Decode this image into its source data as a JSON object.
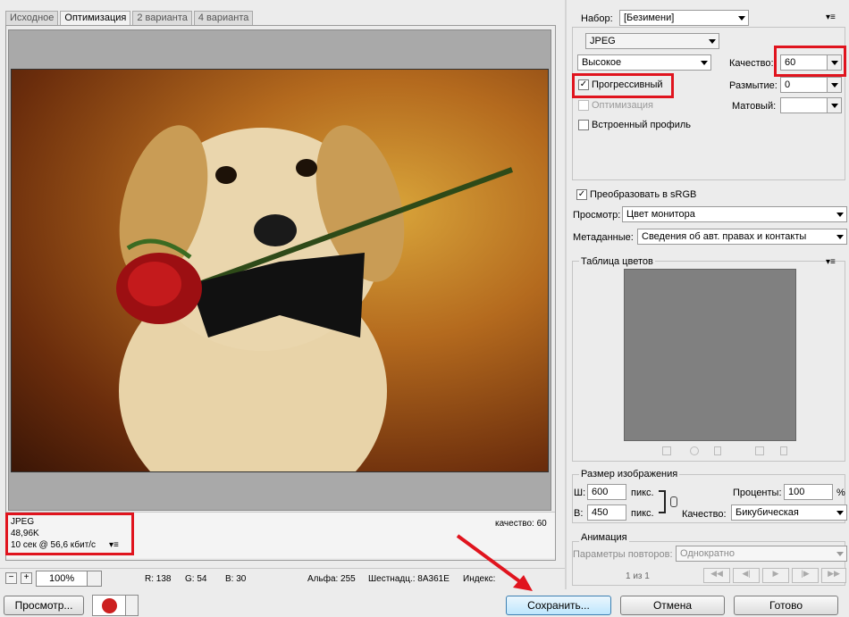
{
  "tabs": [
    "Исходное",
    "Оптимизация",
    "2 варианта",
    "4 варианта"
  ],
  "info": {
    "format": "JPEG",
    "size": "48,96K",
    "speed": "10 сек @ 56,6 кбит/с",
    "quality": "качество: 60"
  },
  "status": {
    "zoom": "100%",
    "r": "R: 138",
    "g": "G: 54",
    "b": "B: 30",
    "alpha": "Альфа: 255",
    "hex": "Шестнадц.: 8A361E",
    "index": "Индекс:"
  },
  "buttons": {
    "preview": "Просмотр...",
    "save": "Сохранить...",
    "cancel": "Отмена",
    "done": "Готово"
  },
  "settings": {
    "preset_label": "Набор:",
    "preset_value": "[Безимени]",
    "format_value": "JPEG",
    "quality_level": "Высокое",
    "quality_label": "Качество:",
    "quality_value": "60",
    "progressive": "Прогрессивный",
    "blur_label": "Размытие:",
    "blur_value": "0",
    "optimized": "Оптимизация",
    "matte_label": "Матовый:",
    "matte_value": "",
    "icc_profile": "Встроенный профиль",
    "srgb": "Преобразовать в sRGB",
    "preview_label": "Просмотр:",
    "preview_value": "Цвет монитора",
    "metadata_label": "Метаданные:",
    "metadata_value": "Сведения об авт. правах и контакты"
  },
  "color_table": {
    "title": "Таблица цветов"
  },
  "image_size": {
    "title": "Размер изображения",
    "w_label": "Ш:",
    "w_value": "600",
    "w_unit": "пикс.",
    "h_label": "В:",
    "h_value": "450",
    "h_unit": "пикс.",
    "percent_label": "Проценты:",
    "percent_value": "100",
    "percent_sign": "%",
    "quality_label": "Качество:",
    "quality_value": "Бикубическая"
  },
  "animation": {
    "title": "Анимация",
    "loop_label": "Параметры повторов:",
    "loop_value": "Однократно",
    "frame": "1 из 1"
  },
  "colors": {
    "highlight": "#e0141e",
    "canvas_gray": "#a9a9a9",
    "swatch_gray": "#808080"
  }
}
